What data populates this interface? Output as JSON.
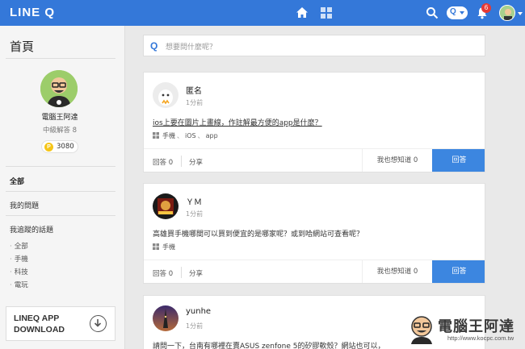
{
  "app": {
    "logo": "LINE Q"
  },
  "topbar": {
    "search_pill": "Q",
    "notifications": "6"
  },
  "search": {
    "q_mark": "Q",
    "placeholder": "想要問什麼呢？"
  },
  "sidebar": {
    "title": "首頁",
    "user": {
      "name": "電腦王阿達",
      "role": "中級解答 8",
      "coin": "P",
      "points": "3080"
    },
    "nav": [
      {
        "label": "全部"
      },
      {
        "label": "我的問題"
      },
      {
        "label": "我追蹤的話題"
      }
    ],
    "topics": [
      "全部",
      "手機",
      "科技",
      "電玩"
    ],
    "app_promo": {
      "label": "LINEQ APP DOWNLOAD"
    }
  },
  "posts": [
    {
      "author": "匿名",
      "time": "1分前",
      "question": "ios上要在圖片上畫線，作註解最方便的app是什麼？",
      "tags": [
        "手機",
        "iOS",
        "app"
      ],
      "answers": "回答 0",
      "share": "分享",
      "want": "我也想知道 0",
      "answer_btn": "回答"
    },
    {
      "author": "ＹＭ",
      "time": "1分前",
      "question": "高雄買手機哪間可以買到便宜的是哪家呢？或到哈網站可查看呢？",
      "tags": [
        "手機"
      ],
      "answers": "回答 0",
      "share": "分享",
      "want": "我也想知道 0",
      "answer_btn": "回答"
    },
    {
      "author": "yunhe",
      "time": "1分前",
      "question": "請問一下，台南有哪裡在賣ASUS zenfone 5的矽膠軟殼？網站也可以，"
    }
  ],
  "watermark": {
    "text": "電腦王阿達",
    "url": "http://www.kocpc.com.tw"
  },
  "colors": {
    "topbar": "#3478d9",
    "answer_button": "#3c86e0",
    "coin": "#f5c518",
    "badge": "#e53935"
  }
}
